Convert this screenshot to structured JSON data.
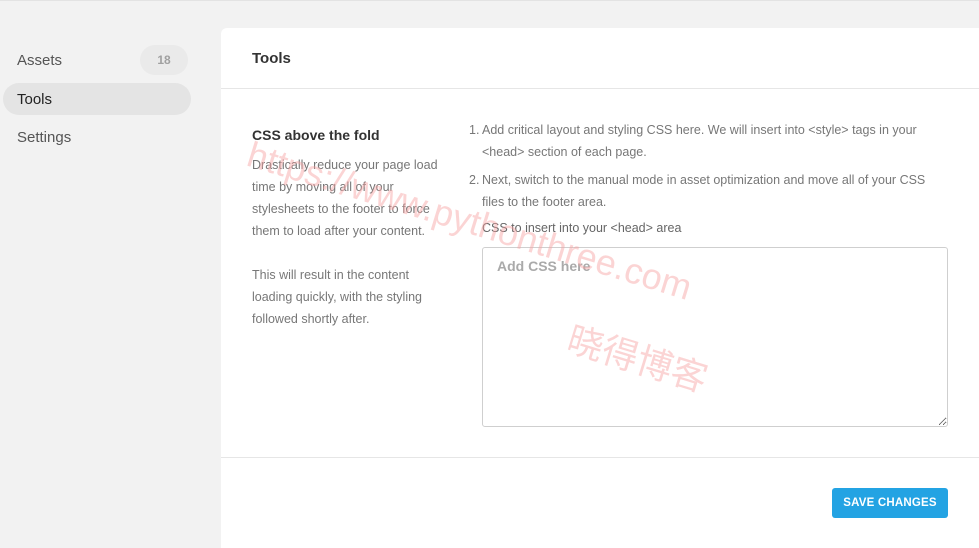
{
  "sidebar": {
    "items": [
      {
        "label": "Assets",
        "badge": "18",
        "active": false
      },
      {
        "label": "Tools",
        "active": true
      },
      {
        "label": "Settings",
        "active": false
      }
    ]
  },
  "panel": {
    "title": "Tools",
    "section": {
      "title": "CSS above the fold",
      "description_1": "Drastically reduce your page load time by moving all of your stylesheets to the footer to force them to load after your content.",
      "description_2": "This will result in the content loading quickly, with the styling followed shortly after."
    },
    "steps": [
      {
        "num": "1.",
        "text": "Add critical layout and styling CSS here. We will insert into <style> tags in your <head> section of each page."
      },
      {
        "num": "2.",
        "text": "Next, switch to the manual mode in asset optimization and move all of your CSS files to the footer area."
      }
    ],
    "field": {
      "label": "CSS to insert into your <head> area",
      "placeholder": "Add CSS here",
      "value": ""
    },
    "save_label": "SAVE CHANGES"
  },
  "watermark": {
    "url_text": "https://www.pythonthree.com",
    "cn_text": "晓得博客",
    "color": "#f6a0a0"
  },
  "colors": {
    "accent": "#23a3e3",
    "background": "#f2f2f2",
    "panel": "#ffffff"
  }
}
